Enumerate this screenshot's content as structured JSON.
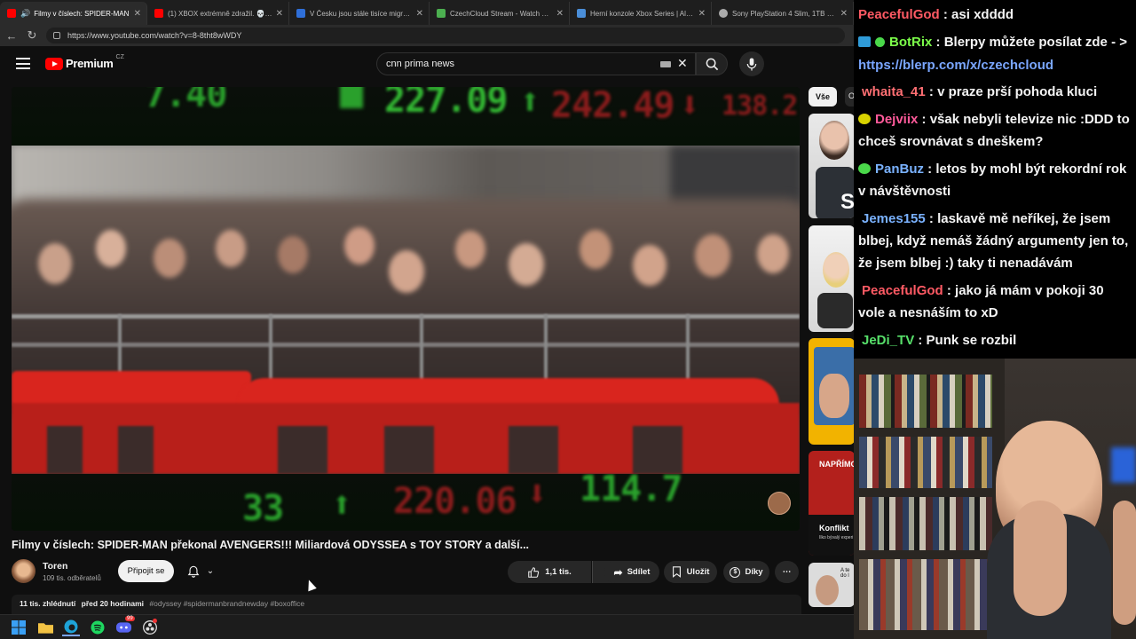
{
  "browser": {
    "tabs": [
      {
        "title": "Filmy v číslech: SPIDER-MAN",
        "color": "#ff0000",
        "active": true
      },
      {
        "title": "(1) XBOX extrémně zdražil. 💀 | R",
        "color": "#ff0000",
        "active": false
      },
      {
        "title": "V Česku jsou stále tisíce migrantů",
        "color": "#2f6fd8",
        "active": false
      },
      {
        "title": "CzechCloud Stream - Watch Live o",
        "color": "#4caf50",
        "active": false
      },
      {
        "title": "Herní konzole Xbox Series | Alza.cz",
        "color": "#4a8ed8",
        "active": false
      },
      {
        "title": "Sony PlayStation 4 Slim, 1TB čern",
        "color": "#aaaaaa",
        "active": false
      }
    ],
    "url": "https://www.youtube.com/watch?v=8-8tht8wWDY"
  },
  "youtube": {
    "logo_text": "Premium",
    "country": "CZ",
    "search_value": "cnn prima news",
    "video": {
      "ticker_top": [
        "7.40",
        "227.09",
        "242.49",
        "138.2"
      ],
      "ticker_bottom": [
        "33",
        "220.06",
        "114.7"
      ],
      "title": "Filmy v číslech: SPIDER-MAN překonal AVENGERS!!! Miliardová ODYSSEA s TOY STORY a další...",
      "channel": "Toren",
      "subscribers": "109 tis. odběratelů",
      "join_label": "Připojit se",
      "likes": "1,1 tis.",
      "share_label": "Sdílet",
      "save_label": "Uložit",
      "thanks_label": "Díky",
      "views": "11 tis. zhlédnutí",
      "published": "před 20 hodinami",
      "tags": "#odyssey #spidermanbrandnewday #boxoffice"
    },
    "sidebar": {
      "chip_all": "Vše",
      "chip_next": "O",
      "thumb_text_1": "S",
      "thumb_text_2": "NAPŘÍMO",
      "thumb_text_3": "Konflikt",
      "thumb_text_4": "Ilko bývalý experi",
      "thumb_text_5": "A te do l"
    }
  },
  "chat": {
    "messages": [
      {
        "user": "PeacefulGod",
        "color": "#ff5a64",
        "badge": "",
        "text": "asi xdddd"
      },
      {
        "user": "BotRix",
        "color": "#7cff4a",
        "badge": "#2f9bd8",
        "text": "Blerpy můžete posílat zde - > ",
        "link": "https://blerp.com/x/czechcloud"
      },
      {
        "user": "whaita_41",
        "color": "#ff6f73",
        "badge": "",
        "text": "v praze prší pohoda kluci"
      },
      {
        "user": "Dejviix",
        "color": "#ff5a9a",
        "badge": "#d8d200",
        "text": "však nebyli televize nic :DDD to chceš srovnávat s dneškem?"
      },
      {
        "user": "PanBuz",
        "color": "#7ab2ff",
        "badge": "#4ad84a",
        "text": "letos by mohl být rekordní rok v návštěvnosti"
      },
      {
        "user": "Jemes155",
        "color": "#7ab2ff",
        "badge": "",
        "text": "laskavě mě neříkej, že jsem blbej, když nemáš žádný argumenty jen to, že jsem blbej :) taky ti nenadávám"
      },
      {
        "user": "PeacefulGod",
        "color": "#ff5a64",
        "badge": "",
        "text": "jako já mám v pokoji 30 vole a nesnáším to xD"
      },
      {
        "user": "JeDi_TV",
        "color": "#57e06a",
        "badge": "",
        "text": "Punk se rozbil"
      }
    ]
  },
  "taskbar": {
    "discord_badge": "99"
  }
}
